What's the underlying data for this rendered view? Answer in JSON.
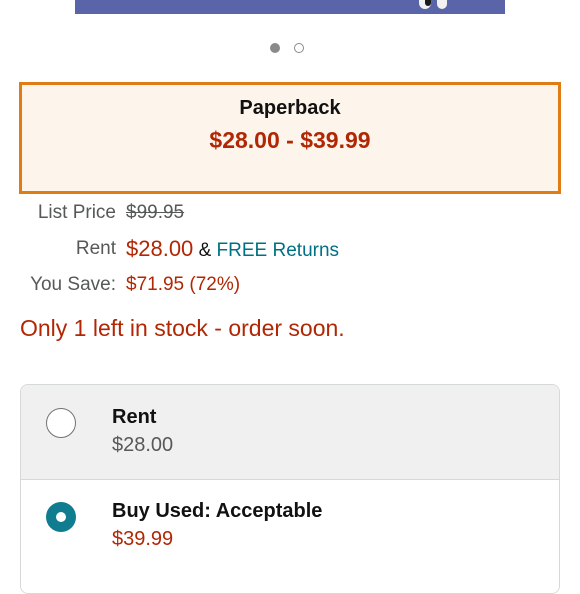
{
  "carousel": {
    "page_count": 2,
    "active_index": 0
  },
  "format": {
    "title": "Paperback",
    "price_range": "$28.00 - $39.99"
  },
  "pricing": {
    "list_price_label": "List Price",
    "list_price_value": "$99.95",
    "rent_label": "Rent",
    "rent_value": "$28.00",
    "amp": "&",
    "free_returns": "FREE Returns",
    "you_save_label": "You Save:",
    "you_save_value": "$71.95 (72%)"
  },
  "stock_message": "Only 1 left in stock - order soon.",
  "options": [
    {
      "title": "Rent",
      "price": "$28.00",
      "selected": false
    },
    {
      "title": "Buy Used: Acceptable",
      "price": "$39.99",
      "selected": true
    }
  ],
  "colors": {
    "accent_orange": "#e07c16",
    "price_red": "#b12704",
    "link_teal": "#007185",
    "radio_teal": "#0f7c90"
  }
}
